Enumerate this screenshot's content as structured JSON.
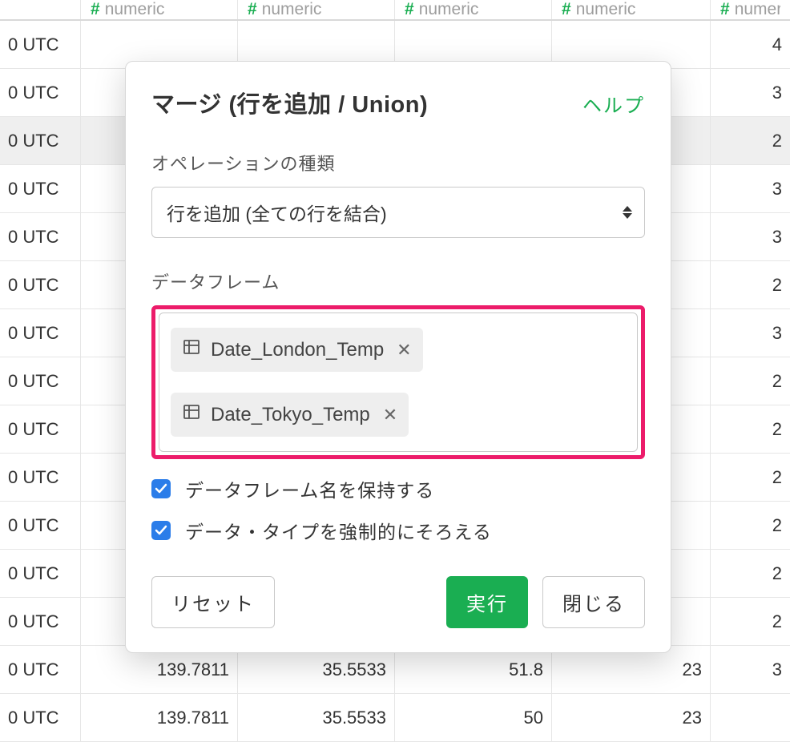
{
  "table": {
    "header_type_label": "numeric",
    "rows": [
      {
        "c0": "0 UTC",
        "c1": "",
        "c2": "",
        "c3": "",
        "c4": "",
        "c5": "4",
        "selected": false
      },
      {
        "c0": "0 UTC",
        "c1": "",
        "c2": "",
        "c3": "",
        "c4": "",
        "c5": "3",
        "selected": false
      },
      {
        "c0": "0 UTC",
        "c1": "",
        "c2": "",
        "c3": "",
        "c4": "",
        "c5": "2",
        "selected": true
      },
      {
        "c0": "0 UTC",
        "c1": "",
        "c2": "",
        "c3": "",
        "c4": "",
        "c5": "3",
        "selected": false
      },
      {
        "c0": "0 UTC",
        "c1": "",
        "c2": "",
        "c3": "",
        "c4": "",
        "c5": "3",
        "selected": false
      },
      {
        "c0": "0 UTC",
        "c1": "",
        "c2": "",
        "c3": "",
        "c4": "",
        "c5": "2",
        "selected": false
      },
      {
        "c0": "0 UTC",
        "c1": "",
        "c2": "",
        "c3": "",
        "c4": "",
        "c5": "3",
        "selected": false
      },
      {
        "c0": "0 UTC",
        "c1": "",
        "c2": "",
        "c3": "",
        "c4": "",
        "c5": "2",
        "selected": false
      },
      {
        "c0": "0 UTC",
        "c1": "",
        "c2": "",
        "c3": "",
        "c4": "",
        "c5": "2",
        "selected": false
      },
      {
        "c0": "0 UTC",
        "c1": "",
        "c2": "",
        "c3": "",
        "c4": "",
        "c5": "2",
        "selected": false
      },
      {
        "c0": "0 UTC",
        "c1": "",
        "c2": "",
        "c3": "",
        "c4": "",
        "c5": "2",
        "selected": false
      },
      {
        "c0": "0 UTC",
        "c1": "",
        "c2": "",
        "c3": "",
        "c4": "",
        "c5": "2",
        "selected": false
      },
      {
        "c0": "0 UTC",
        "c1": "",
        "c2": "",
        "c3": "",
        "c4": "",
        "c5": "2",
        "selected": false
      },
      {
        "c0": "0 UTC",
        "c1": "139.7811",
        "c2": "35.5533",
        "c3": "51.8",
        "c4": "23",
        "c5": "3",
        "selected": false
      },
      {
        "c0": "0 UTC",
        "c1": "139.7811",
        "c2": "35.5533",
        "c3": "50",
        "c4": "23",
        "c5": "",
        "selected": false
      }
    ]
  },
  "modal": {
    "title": "マージ (行を追加 / Union)",
    "help": "ヘルプ",
    "operation_label": "オペレーションの種類",
    "operation_value": "行を追加 (全ての行を結合)",
    "dataframe_label": "データフレーム",
    "dataframes": [
      {
        "name": "Date_London_Temp"
      },
      {
        "name": "Date_Tokyo_Temp"
      }
    ],
    "keep_name_label": "データフレーム名を保持する",
    "force_type_label": "データ・タイプを強制的にそろえる",
    "reset": "リセット",
    "run": "実行",
    "close": "閉じる"
  }
}
